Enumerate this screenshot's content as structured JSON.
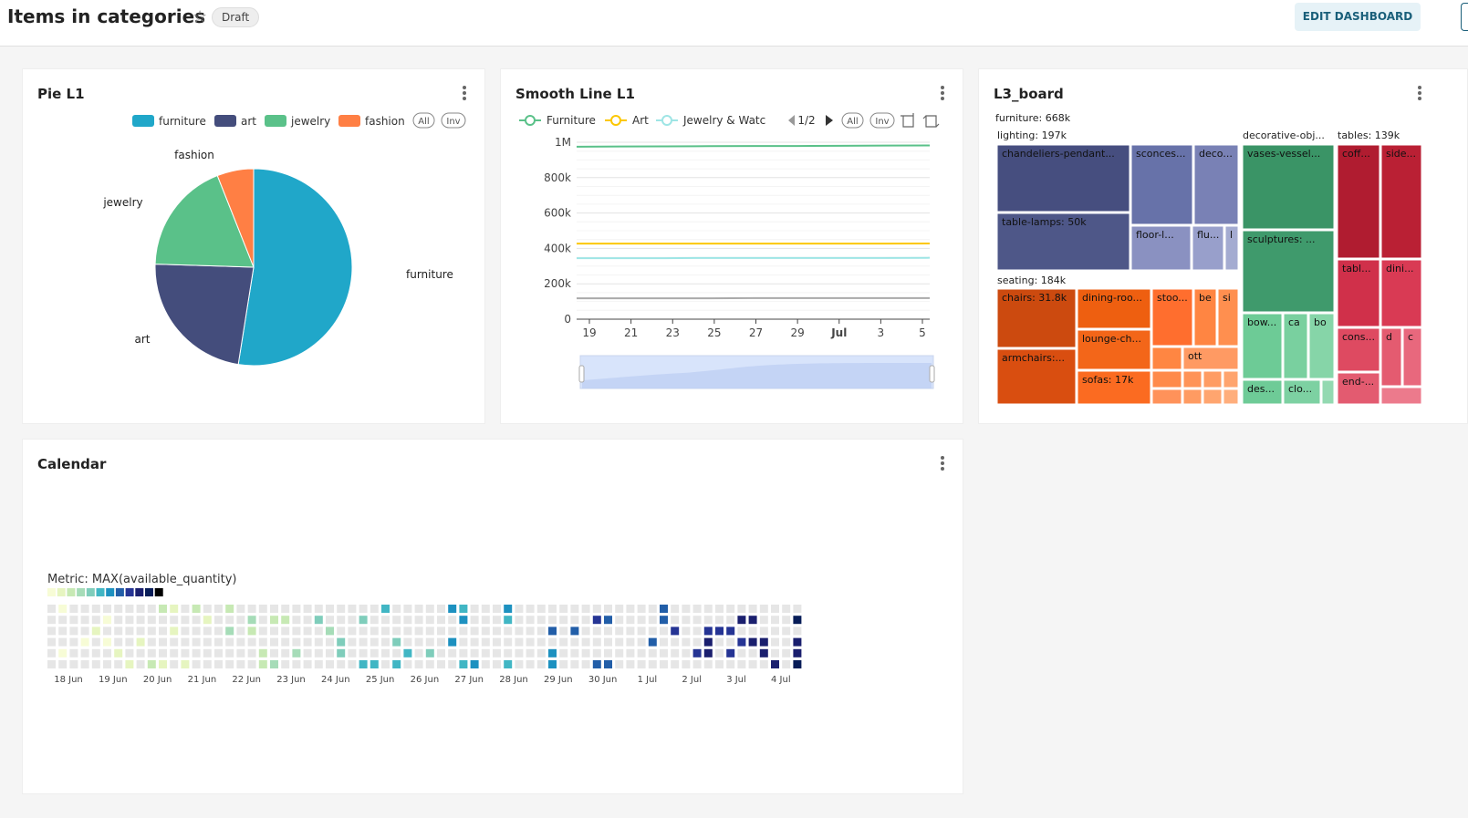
{
  "header": {
    "title": "Items in categories",
    "badge": "Draft",
    "edit_button": "EDIT DASHBOARD"
  },
  "panels": {
    "pie": {
      "title": "Pie L1"
    },
    "line": {
      "title": "Smooth Line L1"
    },
    "tree": {
      "title": "L3_board"
    },
    "calendar": {
      "title": "Calendar"
    }
  },
  "colors": {
    "furniture": "#20a7c9",
    "art": "#444d7c",
    "jewelry": "#5ac189",
    "fashion": "#ff7f44"
  },
  "charts": {
    "pie": {
      "legend": [
        "furniture",
        "art",
        "jewelry",
        "fashion"
      ],
      "legend_all": "All",
      "legend_inv": "Inv"
    },
    "line": {
      "legend": [
        "Furniture",
        "Art",
        "Jewelry & Watch"
      ],
      "page": "1/2",
      "legend_all": "All",
      "legend_inv": "Inv",
      "y_ticks": [
        "0",
        "200k",
        "400k",
        "600k",
        "800k",
        "1M"
      ],
      "x_ticks": [
        "19",
        "21",
        "23",
        "25",
        "27",
        "29",
        "Jul",
        "3",
        "5"
      ]
    },
    "calendar": {
      "metric_label": "Metric: MAX(available_quantity)",
      "date_labels": [
        "18 Jun",
        "19 Jun",
        "20 Jun",
        "21 Jun",
        "22 Jun",
        "23 Jun",
        "24 Jun",
        "25 Jun",
        "26 Jun",
        "27 Jun",
        "28 Jun",
        "29 Jun",
        "30 Jun",
        "1 Jul",
        "2 Jul",
        "3 Jul",
        "4 Jul"
      ],
      "palette": [
        "#f7fcd6",
        "#e6f5c0",
        "#c7e9b4",
        "#a6dcb8",
        "#7fcdbb",
        "#41b6c4",
        "#1d91c0",
        "#225ea8",
        "#253494",
        "#1a1f6e",
        "#081d58",
        "#000000"
      ]
    }
  },
  "chart_data": [
    {
      "type": "pie",
      "slices": [
        {
          "label": "furniture",
          "value": 0.525
        },
        {
          "label": "art",
          "value": 0.23
        },
        {
          "label": "jewelry",
          "value": 0.185
        },
        {
          "label": "fashion",
          "value": 0.06
        }
      ]
    },
    {
      "type": "line",
      "ylim": [
        0,
        1000000
      ],
      "x": [
        "19",
        "21",
        "23",
        "25",
        "27",
        "29",
        "Jul",
        "3",
        "5"
      ],
      "series": [
        {
          "name": "Furniture",
          "color": "#5ac189",
          "values": [
            975000,
            976000,
            977000,
            978000,
            979000,
            979000,
            980000,
            981000,
            982000
          ]
        },
        {
          "name": "Art",
          "color": "#fcc700",
          "values": [
            427000,
            427000,
            427000,
            427000,
            427000,
            427000,
            427000,
            427000,
            428000
          ]
        },
        {
          "name": "Jewelry & Watch",
          "color": "#9ee5e5",
          "values": [
            345000,
            345000,
            345000,
            346000,
            346000,
            346000,
            346000,
            346000,
            347000
          ]
        },
        {
          "name": "",
          "color": "#aaaaaa",
          "values": [
            118000,
            118000,
            118000,
            118000,
            119000,
            119000,
            119000,
            119000,
            119000
          ]
        }
      ]
    },
    {
      "type": "treemap",
      "groups": [
        {
          "label": "furniture: 668k"
        },
        {
          "label": "lighting: 197k",
          "items": [
            "chandeliers-pendant...",
            "sconces...",
            "deco...",
            "table-lamps: 50k",
            "floor-l...",
            "flu...",
            "l"
          ]
        },
        {
          "label": "seating: 184k",
          "items": [
            "chairs: 31.8k",
            "dining-roo...",
            "stoo...",
            "be",
            "si",
            "lounge-ch...",
            "ott",
            "armchairs:...",
            "sofas: 17k"
          ]
        },
        {
          "label": "decorative-obj...",
          "items": [
            "vases-vessel...",
            "sculptures: ...",
            "bow...",
            "ca",
            "bo",
            "des...",
            "clo..."
          ]
        },
        {
          "label": "tables: 139k",
          "items": [
            "coff...",
            "side...",
            "tabl...",
            "dini...",
            "cons...",
            "d",
            "c",
            "end-..."
          ]
        }
      ]
    },
    {
      "type": "heatmap",
      "title": "Metric: MAX(available_quantity)",
      "x": [
        "18 Jun",
        "19 Jun",
        "20 Jun",
        "21 Jun",
        "22 Jun",
        "23 Jun",
        "24 Jun",
        "25 Jun",
        "26 Jun",
        "27 Jun",
        "28 Jun",
        "29 Jun",
        "30 Jun",
        "1 Jul",
        "2 Jul",
        "3 Jul",
        "4 Jul"
      ]
    }
  ]
}
